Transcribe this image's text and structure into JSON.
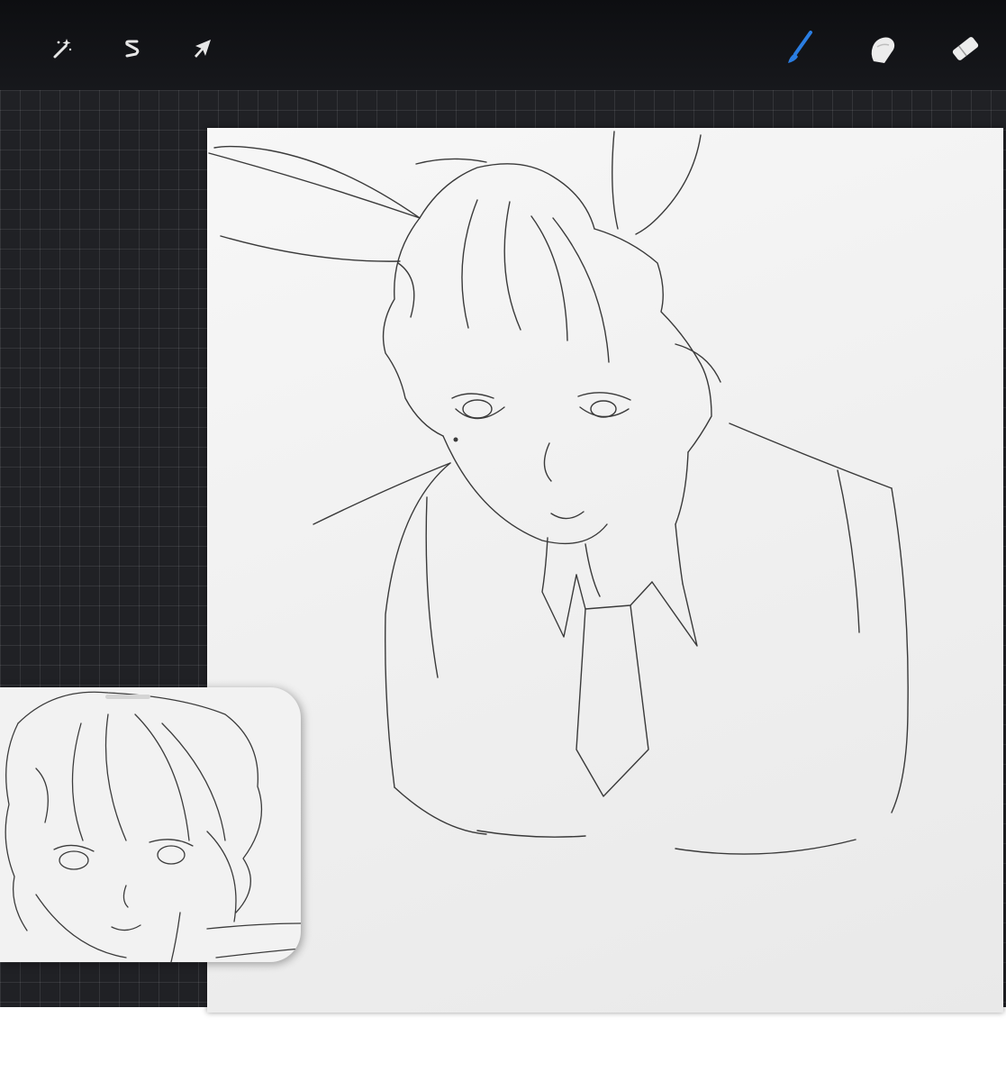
{
  "app": {
    "accent_color": "#2a7de1",
    "toolbar_bg": "#121317",
    "workspace_bg": "#202125",
    "canvas_bg": "#f2f2f2"
  },
  "toolbar": {
    "left_tools": [
      {
        "name": "adjustments-tool",
        "icon": "magic-wand-icon"
      },
      {
        "name": "selection-tool",
        "icon": "selection-s-icon"
      },
      {
        "name": "transform-tool",
        "icon": "arrow-cursor-icon"
      }
    ],
    "right_tools": [
      {
        "name": "brush-tool",
        "icon": "brush-icon",
        "active": true
      },
      {
        "name": "smudge-tool",
        "icon": "smudge-finger-icon",
        "active": false
      },
      {
        "name": "eraser-tool",
        "icon": "eraser-icon",
        "active": false
      }
    ]
  },
  "reference_window": {
    "content": "reference-sketch-portrait"
  }
}
